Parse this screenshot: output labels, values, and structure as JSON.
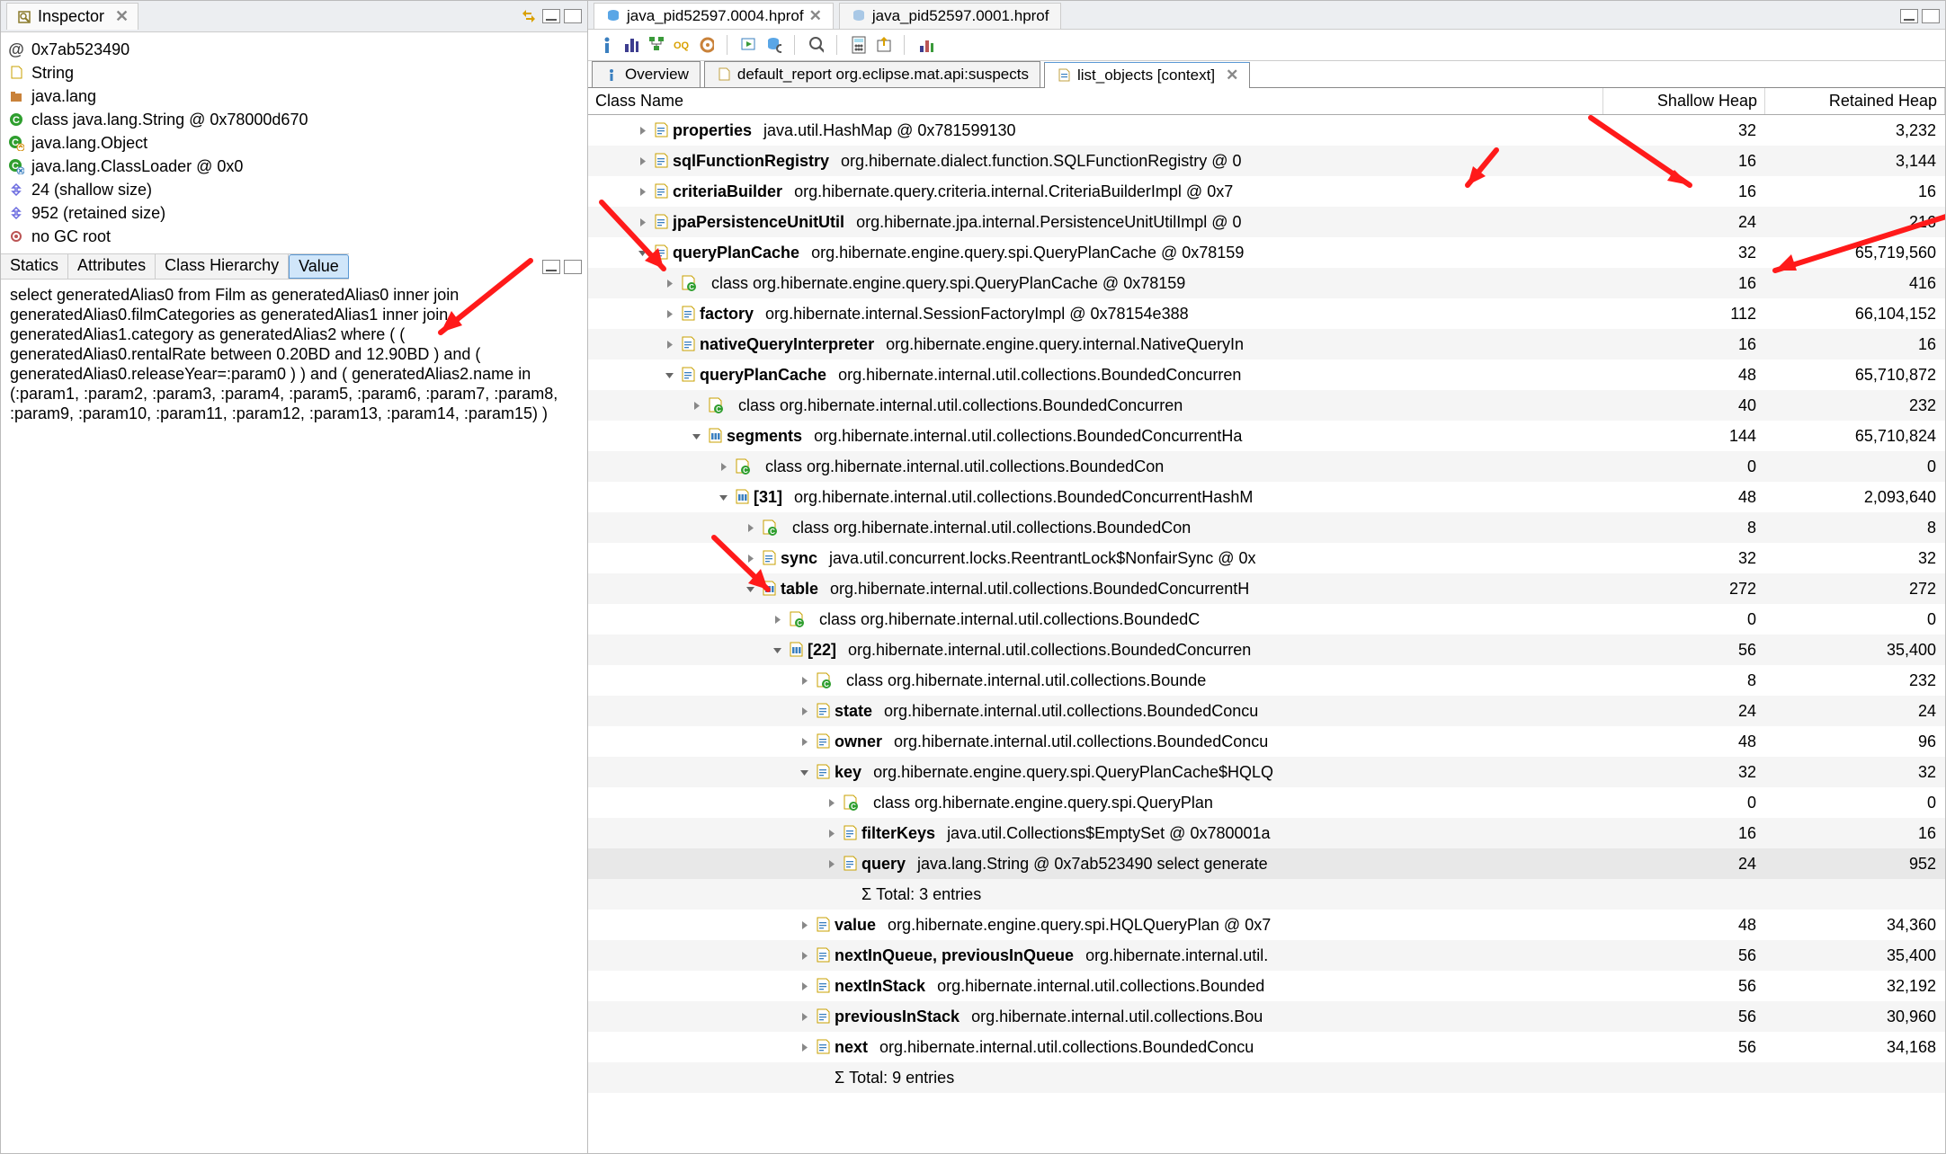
{
  "inspector": {
    "title": "Inspector",
    "items": [
      {
        "iconColor": "#444",
        "glyph": "@",
        "text": "0x7ab523490"
      },
      {
        "iconColor": "#b28a00",
        "glyph": "doc",
        "text": "String"
      },
      {
        "iconColor": "#c06a00",
        "glyph": "pkg",
        "text": "java.lang"
      },
      {
        "iconColor": "#1d7a1d",
        "glyph": "C",
        "text": "class java.lang.String @ 0x78000d670"
      },
      {
        "iconColor": "#1d7a1d",
        "glyph": "Cg",
        "text": "java.lang.Object"
      },
      {
        "iconColor": "#1d7a1d",
        "glyph": "Cg",
        "text": "java.lang.ClassLoader @ 0x0"
      },
      {
        "iconColor": "#6a6adf",
        "glyph": "sz",
        "text": "24 (shallow size)"
      },
      {
        "iconColor": "#6a6adf",
        "glyph": "sz",
        "text": "952 (retained size)"
      },
      {
        "iconColor": "#b55",
        "glyph": "gc",
        "text": "no GC root"
      }
    ],
    "tabs": [
      "Statics",
      "Attributes",
      "Class Hierarchy",
      "Value"
    ],
    "active_tab": 3,
    "value_text": "select generatedAlias0 from Film as generatedAlias0 inner join generatedAlias0.filmCategories as generatedAlias1 inner join generatedAlias1.category as generatedAlias2 where ( ( generatedAlias0.rentalRate between 0.20BD and 12.90BD ) and ( generatedAlias0.releaseYear=:param0 ) ) and ( generatedAlias2.name in (:param1, :param2, :param3, :param4, :param5, :param6, :param7, :param8, :param9, :param10, :param11, :param12, :param13, :param14, :param15) )"
  },
  "editor_tabs": [
    {
      "label": "java_pid52597.0004.hprof",
      "active": true
    },
    {
      "label": "java_pid52597.0001.hprof",
      "active": false
    }
  ],
  "sub_tabs": [
    {
      "label": "Overview",
      "icon": "i",
      "active": false,
      "closeable": false
    },
    {
      "label": "default_report  org.eclipse.mat.api:suspects",
      "icon": "doc",
      "active": false,
      "closeable": false
    },
    {
      "label": "list_objects  [context]",
      "icon": "doc",
      "active": true,
      "closeable": true
    }
  ],
  "table_header": {
    "c1": "Class Name",
    "c2": "Shallow Heap",
    "c3": "Retained Heap"
  },
  "rows": [
    {
      "d": 1,
      "e": "▶",
      "ic": "doc",
      "b": "properties",
      "t": "java.util.HashMap @ 0x781599130",
      "sh": "32",
      "re": "3,232"
    },
    {
      "d": 1,
      "e": "▶",
      "ic": "doc",
      "b": "sqlFunctionRegistry",
      "t": "org.hibernate.dialect.function.SQLFunctionRegistry @ 0",
      "sh": "16",
      "re": "3,144"
    },
    {
      "d": 1,
      "e": "▶",
      "ic": "doc",
      "b": "criteriaBuilder",
      "t": "org.hibernate.query.criteria.internal.CriteriaBuilderImpl @ 0x7",
      "sh": "16",
      "re": "16"
    },
    {
      "d": 1,
      "e": "▶",
      "ic": "doc",
      "b": "jpaPersistenceUnitUtil",
      "t": "org.hibernate.jpa.internal.PersistenceUnitUtilImpl @ 0",
      "sh": "24",
      "re": "216"
    },
    {
      "d": 1,
      "e": "▼",
      "ic": "doc",
      "b": "queryPlanCache",
      "t": "org.hibernate.engine.query.spi.QueryPlanCache @ 0x78159",
      "sh": "32",
      "re": "65,719,560"
    },
    {
      "d": 2,
      "e": "▶",
      "ic": "cls",
      "b": "<class>",
      "t": "class org.hibernate.engine.query.spi.QueryPlanCache @ 0x78159",
      "sh": "16",
      "re": "416"
    },
    {
      "d": 2,
      "e": "▶",
      "ic": "doc",
      "b": "factory",
      "t": "org.hibernate.internal.SessionFactoryImpl @ 0x78154e388",
      "sh": "112",
      "re": "66,104,152"
    },
    {
      "d": 2,
      "e": "▶",
      "ic": "doc",
      "b": "nativeQueryInterpreter",
      "t": "org.hibernate.engine.query.internal.NativeQueryIn",
      "sh": "16",
      "re": "16"
    },
    {
      "d": 2,
      "e": "▼",
      "ic": "doc",
      "b": "queryPlanCache",
      "t": "org.hibernate.internal.util.collections.BoundedConcurren",
      "sh": "48",
      "re": "65,710,872"
    },
    {
      "d": 3,
      "e": "▶",
      "ic": "cls",
      "b": "<class>",
      "t": "class org.hibernate.internal.util.collections.BoundedConcurren",
      "sh": "40",
      "re": "232"
    },
    {
      "d": 3,
      "e": "▼",
      "ic": "arr",
      "b": "segments",
      "t": "org.hibernate.internal.util.collections.BoundedConcurrentHa",
      "sh": "144",
      "re": "65,710,824"
    },
    {
      "d": 4,
      "e": "▶",
      "ic": "cls",
      "b": "<class>",
      "t": "class org.hibernate.internal.util.collections.BoundedCon",
      "sh": "0",
      "re": "0"
    },
    {
      "d": 4,
      "e": "▼",
      "ic": "arr",
      "b": "[31]",
      "t": "org.hibernate.internal.util.collections.BoundedConcurrentHashM",
      "sh": "48",
      "re": "2,093,640"
    },
    {
      "d": 5,
      "e": "▶",
      "ic": "cls",
      "b": "<class>",
      "t": "class org.hibernate.internal.util.collections.BoundedCon",
      "sh": "8",
      "re": "8"
    },
    {
      "d": 5,
      "e": "▶",
      "ic": "doc",
      "b": "sync",
      "t": "java.util.concurrent.locks.ReentrantLock$NonfairSync @ 0x",
      "sh": "32",
      "re": "32"
    },
    {
      "d": 5,
      "e": "▼",
      "ic": "arr",
      "b": "table",
      "t": "org.hibernate.internal.util.collections.BoundedConcurrentH",
      "sh": "272",
      "re": "272"
    },
    {
      "d": 6,
      "e": "▶",
      "ic": "cls",
      "b": "<class>",
      "t": "class org.hibernate.internal.util.collections.BoundedC",
      "sh": "0",
      "re": "0"
    },
    {
      "d": 6,
      "e": "▼",
      "ic": "arr",
      "b": "[22]",
      "t": "org.hibernate.internal.util.collections.BoundedConcurren",
      "sh": "56",
      "re": "35,400"
    },
    {
      "d": 7,
      "e": "▶",
      "ic": "cls",
      "b": "<class>",
      "t": "class org.hibernate.internal.util.collections.Bounde",
      "sh": "8",
      "re": "232"
    },
    {
      "d": 7,
      "e": "▶",
      "ic": "doc",
      "b": "state",
      "t": "org.hibernate.internal.util.collections.BoundedConcu",
      "sh": "24",
      "re": "24"
    },
    {
      "d": 7,
      "e": "▶",
      "ic": "doc",
      "b": "owner",
      "t": "org.hibernate.internal.util.collections.BoundedConcu",
      "sh": "48",
      "re": "96"
    },
    {
      "d": 7,
      "e": "▼",
      "ic": "doc",
      "b": "key",
      "t": "org.hibernate.engine.query.spi.QueryPlanCache$HQLQ",
      "sh": "32",
      "re": "32"
    },
    {
      "d": 8,
      "e": "▶",
      "ic": "cls",
      "b": "<class>",
      "t": "class org.hibernate.engine.query.spi.QueryPlan",
      "sh": "0",
      "re": "0"
    },
    {
      "d": 8,
      "e": "▶",
      "ic": "doc",
      "b": "filterKeys",
      "t": "java.util.Collections$EmptySet @ 0x780001a",
      "sh": "16",
      "re": "16"
    },
    {
      "d": 8,
      "e": "▶",
      "ic": "doc",
      "b": "query",
      "t": "java.lang.String @ 0x7ab523490  select generate",
      "sh": "24",
      "re": "952",
      "sel": true
    },
    {
      "d": 8,
      "e": "",
      "ic": "sum",
      "b": "",
      "t": "Σ Total: 3 entries",
      "sh": "",
      "re": ""
    },
    {
      "d": 7,
      "e": "▶",
      "ic": "doc",
      "b": "value",
      "t": "org.hibernate.engine.query.spi.HQLQueryPlan @ 0x7",
      "sh": "48",
      "re": "34,360"
    },
    {
      "d": 7,
      "e": "▶",
      "ic": "doc",
      "b": "nextInQueue, previousInQueue",
      "t": "org.hibernate.internal.util.",
      "sh": "56",
      "re": "35,400"
    },
    {
      "d": 7,
      "e": "▶",
      "ic": "doc",
      "b": "nextInStack",
      "t": "org.hibernate.internal.util.collections.Bounded",
      "sh": "56",
      "re": "32,192"
    },
    {
      "d": 7,
      "e": "▶",
      "ic": "doc",
      "b": "previousInStack",
      "t": "org.hibernate.internal.util.collections.Bou",
      "sh": "56",
      "re": "30,960"
    },
    {
      "d": 7,
      "e": "▶",
      "ic": "doc",
      "b": "next",
      "t": "org.hibernate.internal.util.collections.BoundedConcu",
      "sh": "56",
      "re": "34,168"
    },
    {
      "d": 7,
      "e": "",
      "ic": "sum",
      "b": "",
      "t": "Σ Total: 9 entries",
      "sh": "",
      "re": ""
    }
  ]
}
